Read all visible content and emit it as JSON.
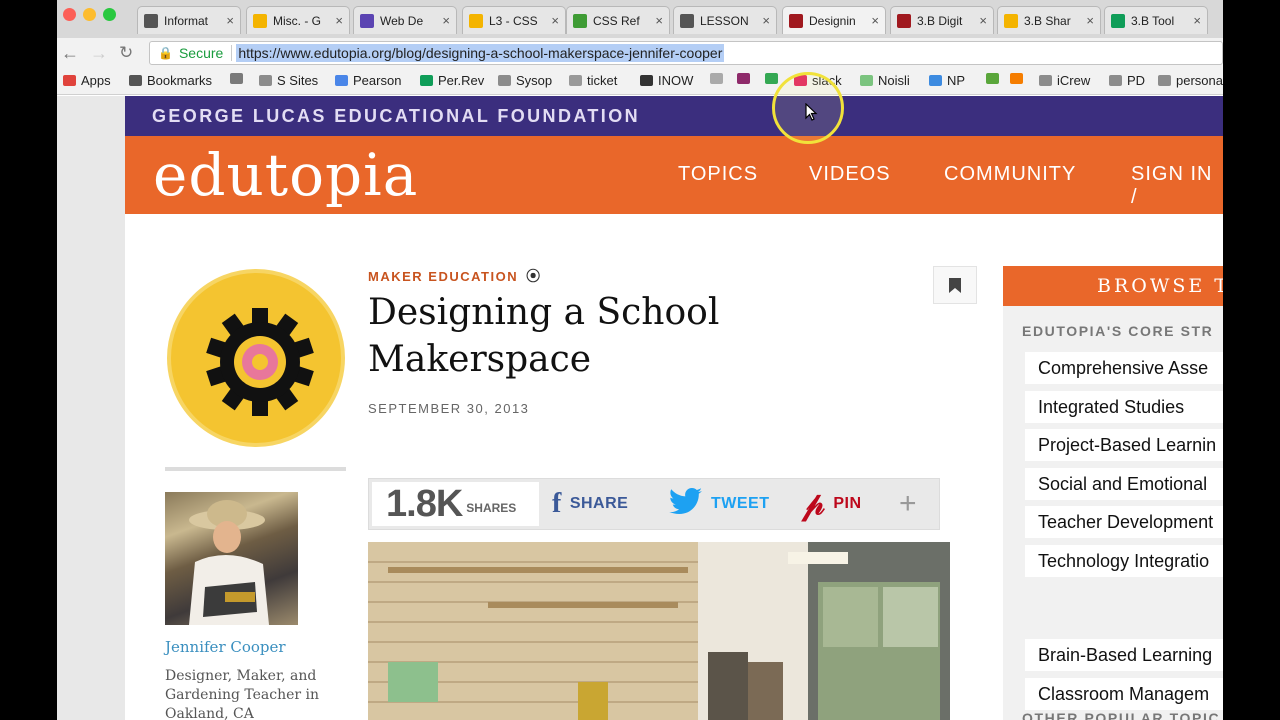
{
  "browser": {
    "tabs": [
      {
        "title": "Informat",
        "color": "#555555"
      },
      {
        "title": "Misc. - G",
        "color": "#f4b400"
      },
      {
        "title": "Web De",
        "color": "#5b44b2"
      },
      {
        "title": "L3 - CSS",
        "color": "#f4b400"
      },
      {
        "title": "CSS Ref",
        "color": "#3f9c35"
      },
      {
        "title": "LESSON",
        "color": "#555555"
      },
      {
        "title": "Designin",
        "color": "#a0191f"
      },
      {
        "title": "3.B Digit",
        "color": "#a0191f"
      },
      {
        "title": "3.B Shar",
        "color": "#f4b400"
      },
      {
        "title": "3.B Tool",
        "color": "#0f9d58"
      }
    ],
    "omnibox": {
      "secure_label": "Secure",
      "url": "https://www.edutopia.org/blog/designing-a-school-makerspace-jennifer-cooper"
    },
    "bookmarks": [
      {
        "label": "Apps",
        "icon": "apps-grid-icon"
      },
      {
        "label": "Bookmarks",
        "icon": "star-icon"
      },
      {
        "label": "",
        "icon": "frog-icon"
      },
      {
        "label": "S Sites",
        "icon": "folder-icon"
      },
      {
        "label": "Pearson",
        "icon": "docs-icon"
      },
      {
        "label": "Per.Rev",
        "icon": "sheets-icon"
      },
      {
        "label": "Sysop",
        "icon": "folder-icon"
      },
      {
        "label": "ticket",
        "icon": "ticket-icon"
      },
      {
        "label": "INOW",
        "icon": "inow-icon"
      },
      {
        "label": "",
        "icon": "page-icon"
      },
      {
        "label": "",
        "icon": "contact-icon"
      },
      {
        "label": "",
        "icon": "drive-icon"
      },
      {
        "label": "slack",
        "icon": "slack-icon"
      },
      {
        "label": "Noisli",
        "icon": "noisli-icon"
      },
      {
        "label": "NP",
        "icon": "np-icon"
      },
      {
        "label": "",
        "icon": "leaf-icon"
      },
      {
        "label": "",
        "icon": "blogger-icon"
      },
      {
        "label": "iCrew",
        "icon": "folder-icon"
      },
      {
        "label": "PD",
        "icon": "folder-icon"
      },
      {
        "label": "persona",
        "icon": "folder-icon"
      }
    ]
  },
  "site": {
    "foundation": "GEORGE LUCAS EDUCATIONAL FOUNDATION",
    "logo": "edutopia",
    "nav": [
      "TOPICS",
      "VIDEOS",
      "COMMUNITY",
      "SIGN IN /"
    ]
  },
  "article": {
    "category": "MAKER EDUCATION",
    "title": "Designing a School Makerspace",
    "date": "SEPTEMBER 30, 2013",
    "share": {
      "count": "1.8K",
      "count_label": "SHARES",
      "share": "SHARE",
      "tweet": "TWEET",
      "pin": "PIN",
      "more": "+"
    },
    "author": {
      "name": "Jennifer Cooper",
      "bio": "Designer, Maker, and Gardening Teacher in Oakland, CA"
    }
  },
  "sidebar": {
    "browse_title": "BROWSE T",
    "core_heading": "EDUTOPIA'S CORE STR",
    "core_items": [
      "Comprehensive Asse",
      "Integrated Studies",
      "Project-Based Learnin",
      "Social and Emotional",
      "Teacher Development",
      "Technology Integratio"
    ],
    "popular_heading": "OTHER POPULAR TOPIC",
    "popular_items": [
      "Brain-Based Learning",
      "Classroom Managem"
    ]
  },
  "colors": {
    "brand_orange": "#e9672a",
    "brand_purple": "#3b2e7e",
    "facebook": "#3b5998",
    "twitter": "#1da1f2",
    "pinterest": "#bd081c"
  }
}
